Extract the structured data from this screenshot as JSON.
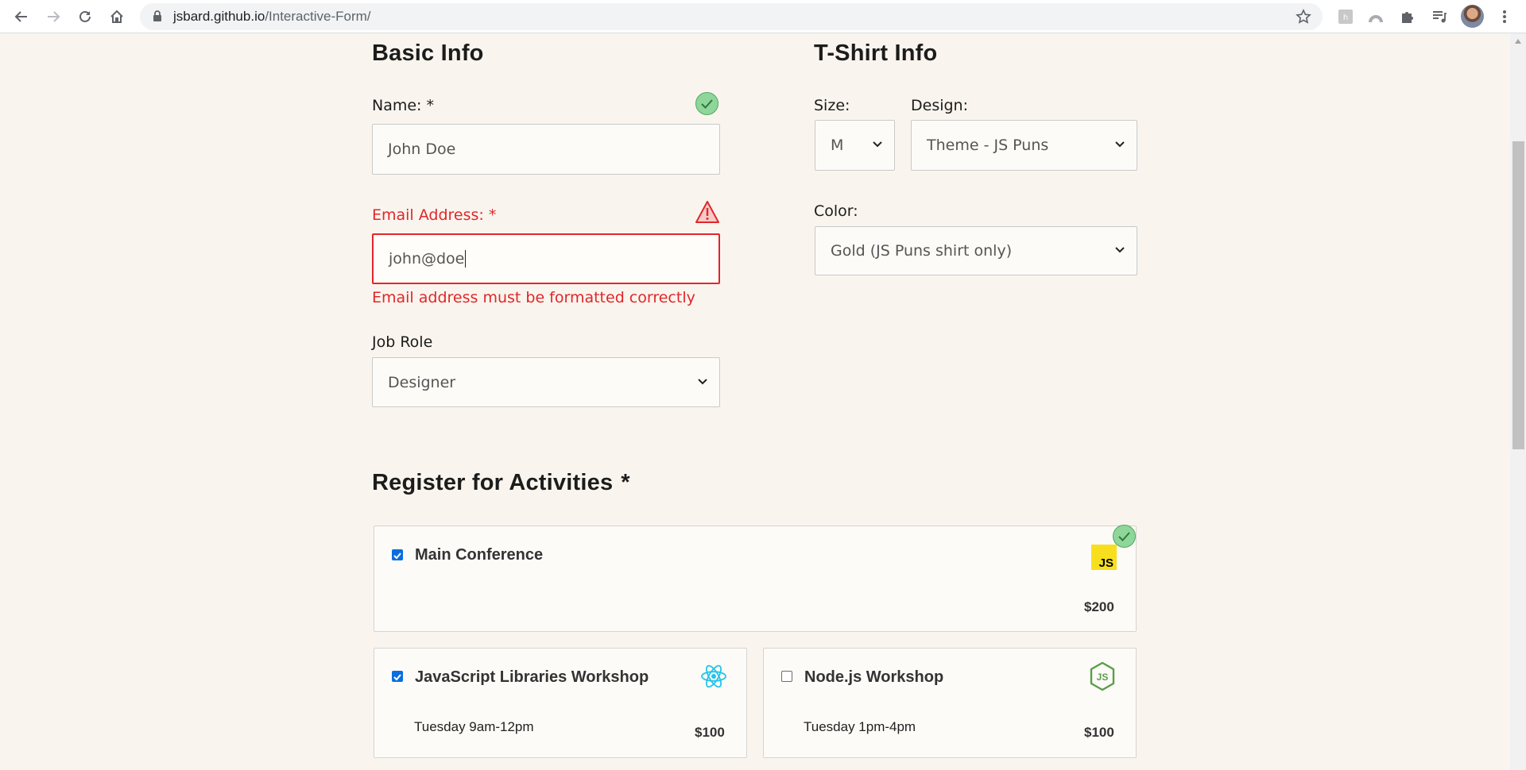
{
  "browser": {
    "url_domain": "jsbard.github.io",
    "url_path": "/Interactive-Form/"
  },
  "basic_info": {
    "title": "Basic Info",
    "name": {
      "label": "Name:",
      "required": "*",
      "value": "John Doe",
      "status": "valid"
    },
    "email": {
      "label": "Email Address:",
      "required": "*",
      "value": "john@doe",
      "status": "error",
      "error": "Email address must be formatted correctly"
    },
    "job_role": {
      "label": "Job Role",
      "value": "Designer"
    }
  },
  "tshirt": {
    "title": "T-Shirt Info",
    "size": {
      "label": "Size:",
      "value": "M"
    },
    "design": {
      "label": "Design:",
      "value": "Theme - JS Puns"
    },
    "color": {
      "label": "Color:",
      "value": "Gold (JS Puns shirt only)"
    }
  },
  "activities": {
    "title": "Register for Activities",
    "required": "*",
    "status": "valid",
    "items": [
      {
        "name": "Main Conference",
        "time": "",
        "cost": "$200",
        "checked": true,
        "icon": "js-logo-icon"
      },
      {
        "name": "JavaScript Libraries Workshop",
        "time": "Tuesday 9am-12pm",
        "cost": "$100",
        "checked": true,
        "icon": "react-logo-icon"
      },
      {
        "name": "Node.js Workshop",
        "time": "Tuesday 1pm-4pm",
        "cost": "$100",
        "checked": false,
        "icon": "nodejs-logo-icon"
      }
    ]
  },
  "colors": {
    "page_bg": "#f9f5ee",
    "error": "#e2262a",
    "valid": "#8fd69b",
    "checkbox_checked": "#0b6ee0"
  }
}
